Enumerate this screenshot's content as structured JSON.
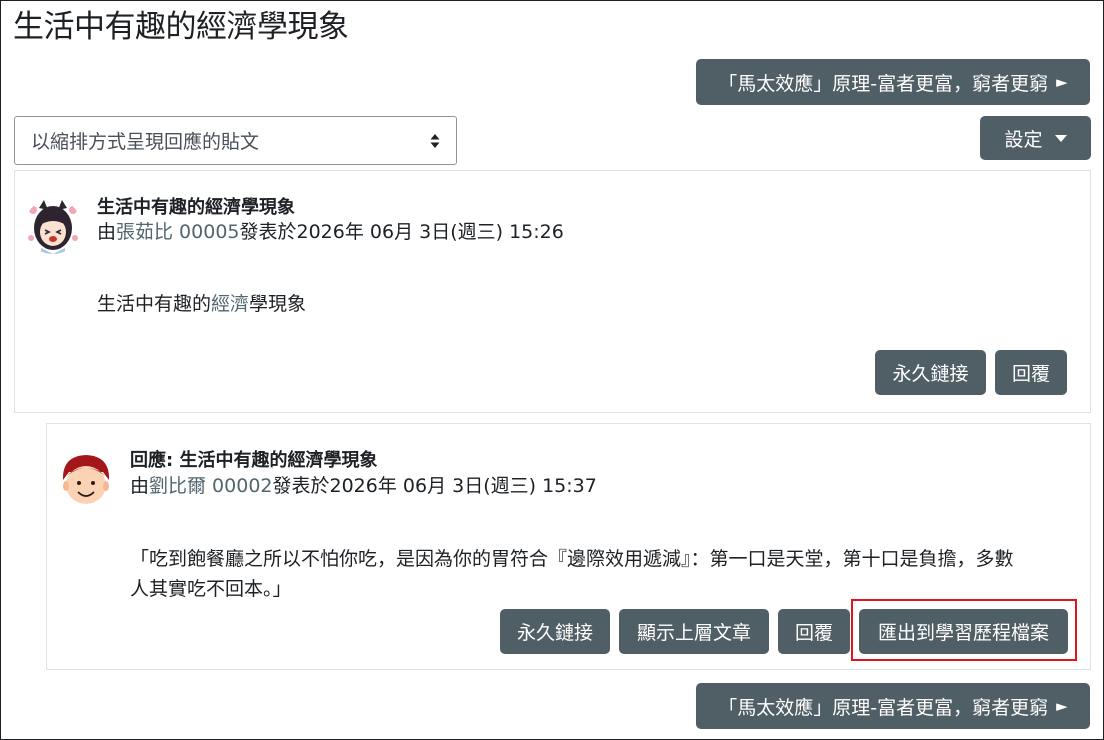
{
  "page": {
    "title": "生活中有趣的經濟學現象"
  },
  "nav": {
    "next_discussion_label": "「馬太效應」原理-富者更富，窮者更窮",
    "arrow": "►"
  },
  "display_mode": {
    "selected": "以縮排方式呈現回應的貼文"
  },
  "settings": {
    "label": "設定"
  },
  "posts": [
    {
      "subject": "生活中有趣的經濟學現象",
      "by_prefix": "由",
      "author": "張茹比 00005",
      "posted_suffix": "發表於2026年 06月 3日(週三) 15:26",
      "body_before": "生活中有趣的",
      "body_keyword": "經濟",
      "body_after": "學現象",
      "actions": {
        "permalink": "永久鏈接",
        "reply": "回覆"
      }
    },
    {
      "subject": "回應: 生活中有趣的經濟學現象",
      "by_prefix": "由",
      "author": "劉比爾 00002",
      "posted_suffix": "發表於2026年 06月 3日(週三) 15:37",
      "body_line1": "「吃到飽餐廳之所以不怕你吃，是因為你的胃符合『邊際效用遞減』：第一口是天堂，第十口是負擔，多數",
      "body_line2": "人其實吃不回本。」",
      "actions": {
        "permalink": "永久鏈接",
        "show_parent": "顯示上層文章",
        "reply": "回覆",
        "export_portfolio": "匯出到學習歷程檔案"
      }
    }
  ],
  "colors": {
    "button_bg": "#505e66",
    "link": "#51666f",
    "highlight": "#e0141b"
  }
}
